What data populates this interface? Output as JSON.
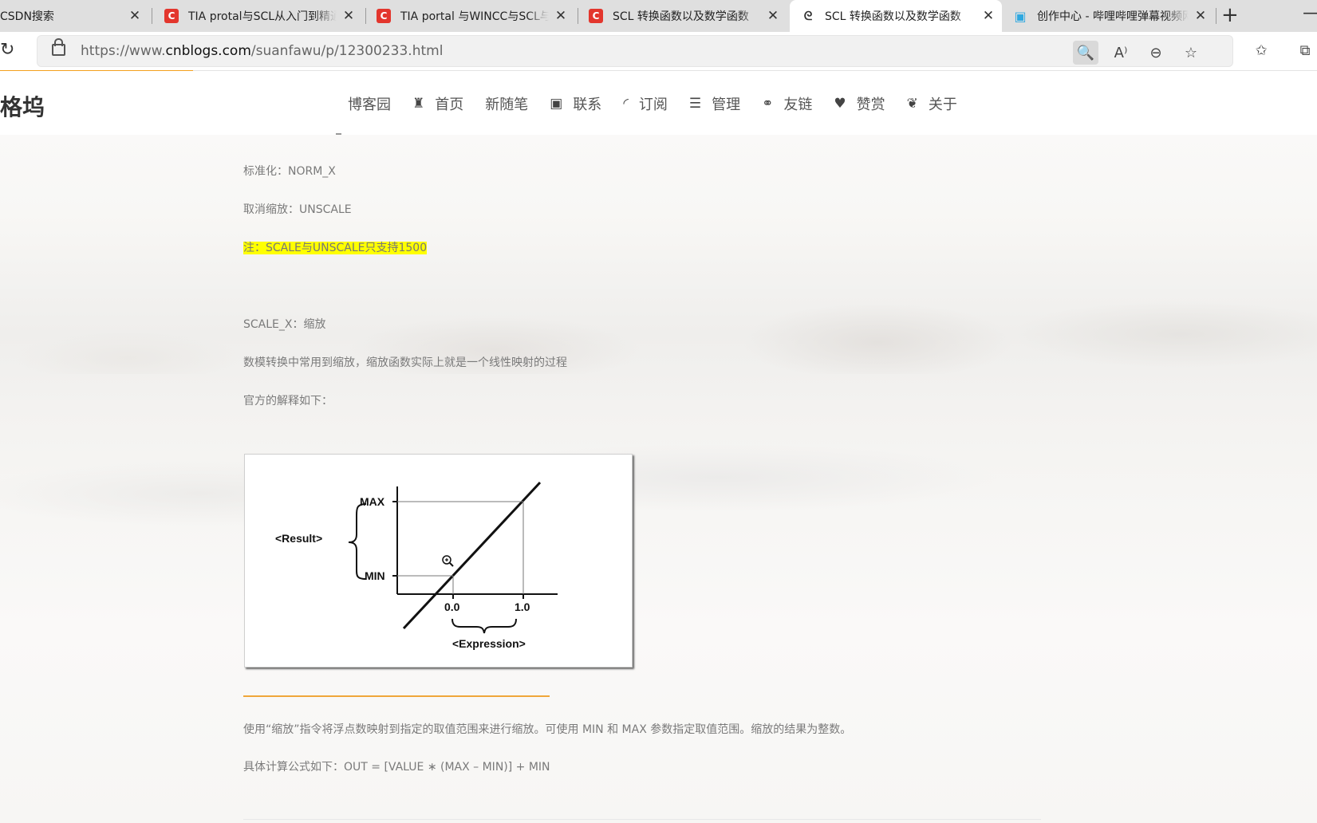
{
  "browser": {
    "tabs": [
      {
        "title": "CSDN搜索",
        "icon": "csdn-icon"
      },
      {
        "title": "TIA protal与SCL从入门到精通",
        "icon": "csdn-icon"
      },
      {
        "title": "TIA portal 与WINCC与SCL与",
        "icon": "csdn-icon"
      },
      {
        "title": "SCL 转换函数以及数学函数",
        "icon": "csdn-icon"
      },
      {
        "title": "SCL 转换函数以及数学函数",
        "icon": "cnblogs-icon",
        "active": true
      },
      {
        "title": "创作中心 - 哔哩哔哩弹幕视频网",
        "icon": "bilibili-icon"
      }
    ],
    "url_prefix": "https://www.",
    "url_domain": "cnblogs.com",
    "url_path": "/suanfawu/p/12300233.html"
  },
  "header": {
    "brand": "格坞",
    "nav": [
      {
        "label": "博客园",
        "icon": ""
      },
      {
        "label": "首页",
        "icon": "castle-icon"
      },
      {
        "label": "新随笔",
        "icon": ""
      },
      {
        "label": "联系",
        "icon": "contact-icon"
      },
      {
        "label": "订阅",
        "icon": "rss-icon"
      },
      {
        "label": "管理",
        "icon": "list-icon"
      },
      {
        "label": "友链",
        "icon": "link-icon"
      },
      {
        "label": "赞赏",
        "icon": "heart-icon"
      },
      {
        "label": "关于",
        "icon": "leaf-icon"
      }
    ]
  },
  "article": {
    "line1": "标准化：NORM_X",
    "line2": "取消缩放：UNSCALE",
    "note": "注：SCALE与UNSCALE只支持1500",
    "line3": "SCALE_X：缩放",
    "line4": "数模转换中常用到缩放，缩放函数实际上就是一个线性映射的过程",
    "line5": "官方的解释如下：",
    "desc": "使用“缩放”指令将浮点数映射到指定的取值范围来进行缩放。可使用 MIN 和 MAX 参数指定取值范围。缩放的结果为整数。",
    "formula": "具体计算公式如下：OUT = [VALUE ∗ (MAX – MIN)] + MIN"
  },
  "figure": {
    "result_label": "<Result>",
    "max_label": "MAX",
    "min_label": "MIN",
    "x0_label": "0.0",
    "x1_label": "1.0",
    "expression_label": "<Expression>"
  }
}
